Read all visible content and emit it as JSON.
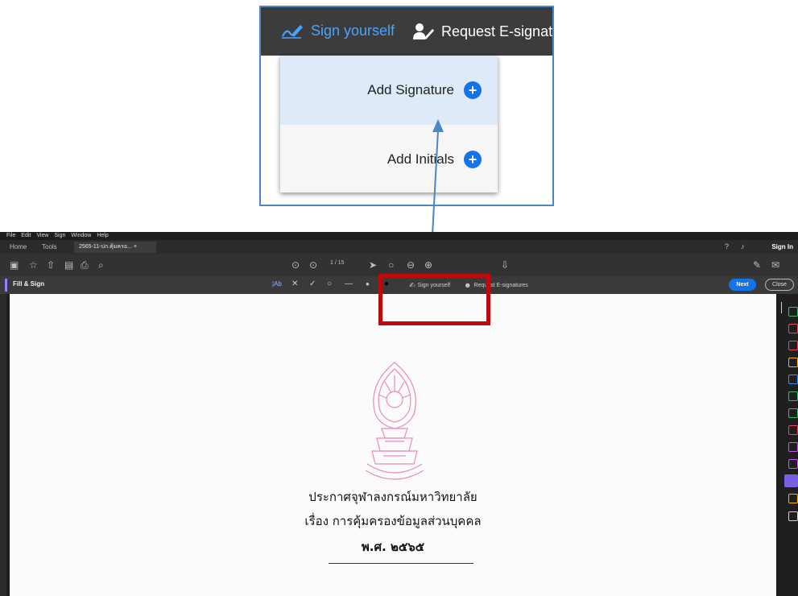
{
  "callout": {
    "sign_yourself": "Sign yourself",
    "request_esignatures": "Request E-signatur",
    "add_signature": "Add Signature",
    "add_initials": "Add Initials"
  },
  "app": {
    "menu": [
      "File",
      "Edit",
      "View",
      "Sign",
      "Window",
      "Help"
    ],
    "tabs": {
      "home": "Home",
      "tools": "Tools",
      "document": "2565-11-ปก.คุ้มครอ... ×"
    },
    "sign_in": "Sign In",
    "page_indicator": "1 / 15",
    "fill_sign": {
      "title": "Fill & Sign",
      "sign_yourself": "Sign yourself",
      "request_esignatures": "Request E-signatures",
      "next": "Next",
      "close": "Close"
    },
    "document": {
      "line1": "ประกาศจุฬาลงกรณ์มหาวิทยาลัย",
      "line2": "เรื่อง การคุ้มครองข้อมูลส่วนบุคคล",
      "line3": "พ.ศ. ๒๕๖๕"
    }
  },
  "colors": {
    "accent": "#1473e6",
    "highlight": "#c0090f",
    "arrow": "#4a86c8",
    "seal": "#e88bbd"
  }
}
